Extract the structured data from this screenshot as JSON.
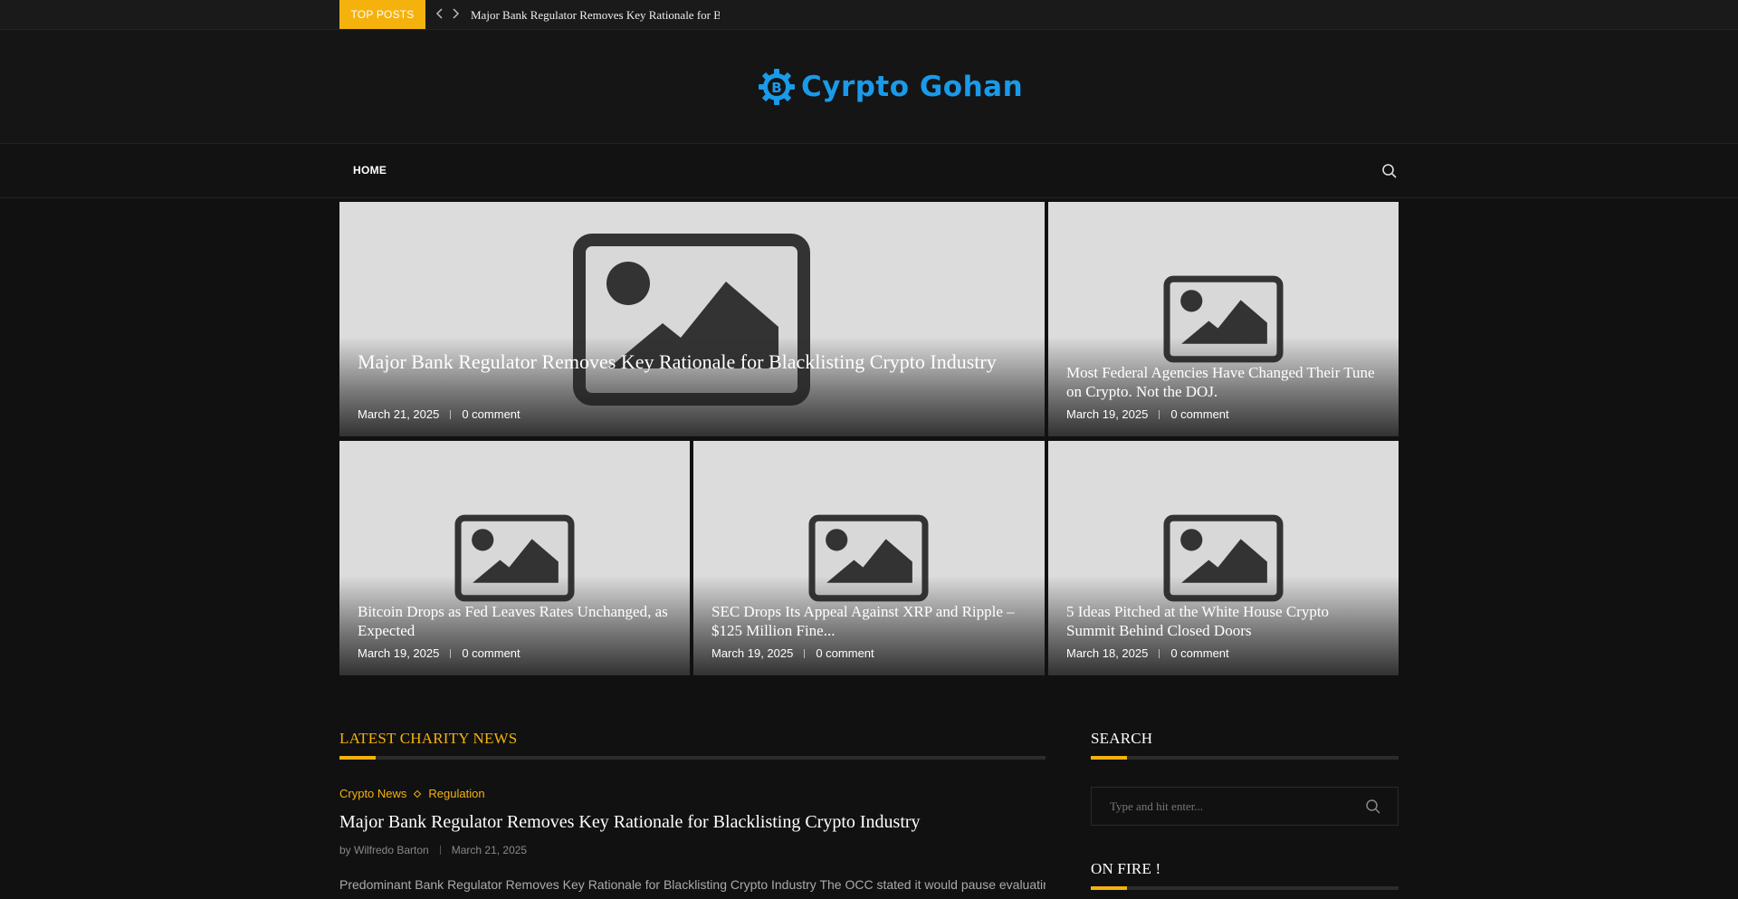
{
  "topbar": {
    "badge": "TOP POSTS",
    "ticker": "Major Bank Regulator Removes Key Rationale for Blacklisting Crypto Industry"
  },
  "brand": {
    "name": "Cyrpto Gohan",
    "color": "#1a9ae8"
  },
  "nav": {
    "home": "HOME",
    "search_icon": "search-icon"
  },
  "featured": [
    {
      "title": "Major Bank Regulator Removes Key Rationale for Blacklisting Crypto Industry",
      "date": "March 21, 2025",
      "comments": "0 comment"
    },
    {
      "title": "Most Federal Agencies Have Changed Their Tune on Crypto. Not the DOJ.",
      "date": "March 19, 2025",
      "comments": "0 comment"
    },
    {
      "title": "Bitcoin Drops as Fed Leaves Rates Unchanged, as Expected",
      "date": "March 19, 2025",
      "comments": "0 comment"
    },
    {
      "title": "SEC Drops Its Appeal Against XRP and Ripple – $125 Million Fine...",
      "date": "March 19, 2025",
      "comments": "0 comment"
    },
    {
      "title": "5 Ideas Pitched at the White House Crypto Summit Behind Closed Doors",
      "date": "March 18, 2025",
      "comments": "0 comment"
    }
  ],
  "latest": {
    "heading": "LATEST CHARITY NEWS",
    "categories": [
      "Crypto News",
      "Regulation"
    ],
    "post_title": "Major Bank Regulator Removes Key Rationale for Blacklisting Crypto Industry",
    "author": "by Wilfredo Barton",
    "date": "March 21, 2025",
    "excerpt": "Predominant Bank Regulator Removes Key Rationale for Blacklisting Crypto Industry The OCC stated it would pause evaluating"
  },
  "sidebar": {
    "search_heading": "SEARCH",
    "search_placeholder": "Type and hit enter...",
    "on_fire_heading": "ON FIRE !"
  },
  "colors": {
    "accent": "#f5b20d",
    "background": "#111111",
    "placeholder": "#dcdcdc"
  }
}
